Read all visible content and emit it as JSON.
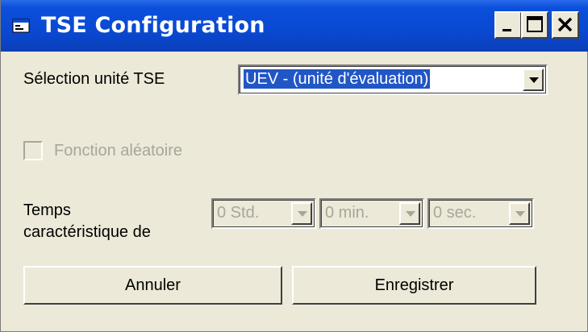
{
  "window": {
    "title": "TSE Configuration",
    "icon": "window-app-icon",
    "controls": [
      "minimize-icon",
      "maximize-icon",
      "close-icon"
    ]
  },
  "unit_selection": {
    "label": "Sélection unité TSE",
    "selected_value": "UEV - (unité d'évaluation)"
  },
  "random_function": {
    "label": "Fonction aléatoire",
    "checked": false,
    "enabled": false
  },
  "time": {
    "label_line1": "Temps",
    "label_line2": "caractéristique de",
    "hours": "0 Std.",
    "minutes": "0 min.",
    "seconds": "0 sec.",
    "enabled": false
  },
  "buttons": {
    "cancel_label": "Annuler",
    "save_label": "Enregistrer"
  },
  "colors": {
    "title_bar": "#0a49d2",
    "face": "#ece9d8",
    "selection": "#2156c6",
    "disabled_text": "#a7a69c"
  }
}
